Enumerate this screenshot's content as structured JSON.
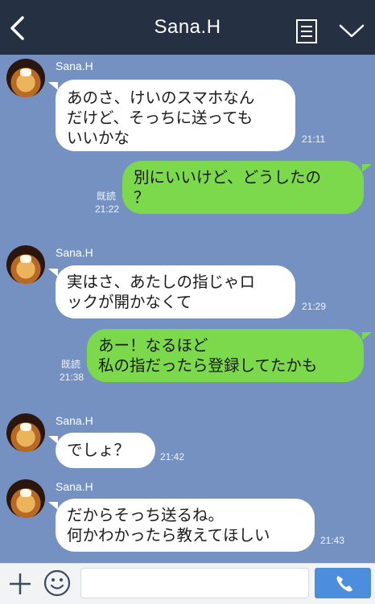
{
  "header": {
    "title": "Sana.H",
    "back_icon": "chevron-left-icon",
    "note_icon": "note-icon",
    "menu_icon": "chevron-down-icon"
  },
  "messages": [
    {
      "sender": "Sana.H",
      "lines": [
        "あのさ、けいのスマホなん",
        "だけど、そっちに送っても",
        "いいかな"
      ],
      "time": "21:11"
    },
    {
      "lines": [
        "別にいいけど、どうしたの",
        "？"
      ],
      "read": "既読",
      "time": "21:22"
    },
    {
      "sender": "Sana.H",
      "lines": [
        "実はさ、あたしの指じゃロ",
        "ックが開かなくて"
      ],
      "time": "21:29"
    },
    {
      "lines": [
        "あー！なるほど",
        "私の指だったら登録してたかも"
      ],
      "read": "既読",
      "time": "21:38"
    },
    {
      "sender": "Sana.H",
      "lines": [
        "でしょ？"
      ],
      "time": "21:42"
    },
    {
      "sender": "Sana.H",
      "lines": [
        "だからそっち送るね。",
        "何かわかったら教えてほしい"
      ],
      "time": "21:43"
    }
  ],
  "footer": {
    "input_value": "",
    "plus_icon": "plus-icon",
    "emoji_icon": "emoji-icon",
    "call_icon": "phone-icon"
  },
  "colors": {
    "background": "#7491c2",
    "header": "#253042",
    "incoming_bubble": "#ffffff",
    "outgoing_bubble": "#7bd94b",
    "call_button": "#4d8ddd"
  }
}
